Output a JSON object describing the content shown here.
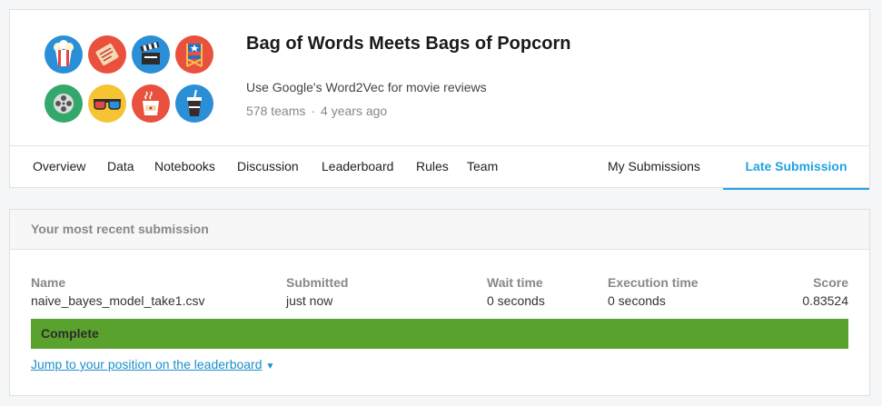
{
  "competition": {
    "title": "Bag of Words Meets Bags of Popcorn",
    "subtitle": "Use Google's Word2Vec for movie reviews",
    "teams": "578 teams",
    "separator": "·",
    "age": "4 years ago",
    "logo_icons": [
      "popcorn-icon",
      "ticket-icon",
      "clapperboard-icon",
      "directors-chair-icon",
      "film-reel-icon",
      "3d-glasses-icon",
      "coffee-cup-icon",
      "soda-cup-icon"
    ]
  },
  "tabs": {
    "overview": "Overview",
    "data": "Data",
    "notebooks": "Notebooks",
    "discussion": "Discussion",
    "leaderboard": "Leaderboard",
    "rules": "Rules",
    "team": "Team",
    "my_submissions": "My Submissions",
    "late_submission": "Late Submission"
  },
  "submission": {
    "heading": "Your most recent submission",
    "name_label": "Name",
    "name_value": "naive_bayes_model_take1.csv",
    "submitted_label": "Submitted",
    "submitted_value": "just now",
    "wait_label": "Wait time",
    "wait_value": "0 seconds",
    "exec_label": "Execution time",
    "exec_value": "0 seconds",
    "score_label": "Score",
    "score_value": "0.83524",
    "status": "Complete",
    "status_color": "#5aa22e",
    "jump_link": "Jump to your position on the leaderboard"
  },
  "colors": {
    "accent": "#20a4e0",
    "link": "#1b8fca"
  }
}
